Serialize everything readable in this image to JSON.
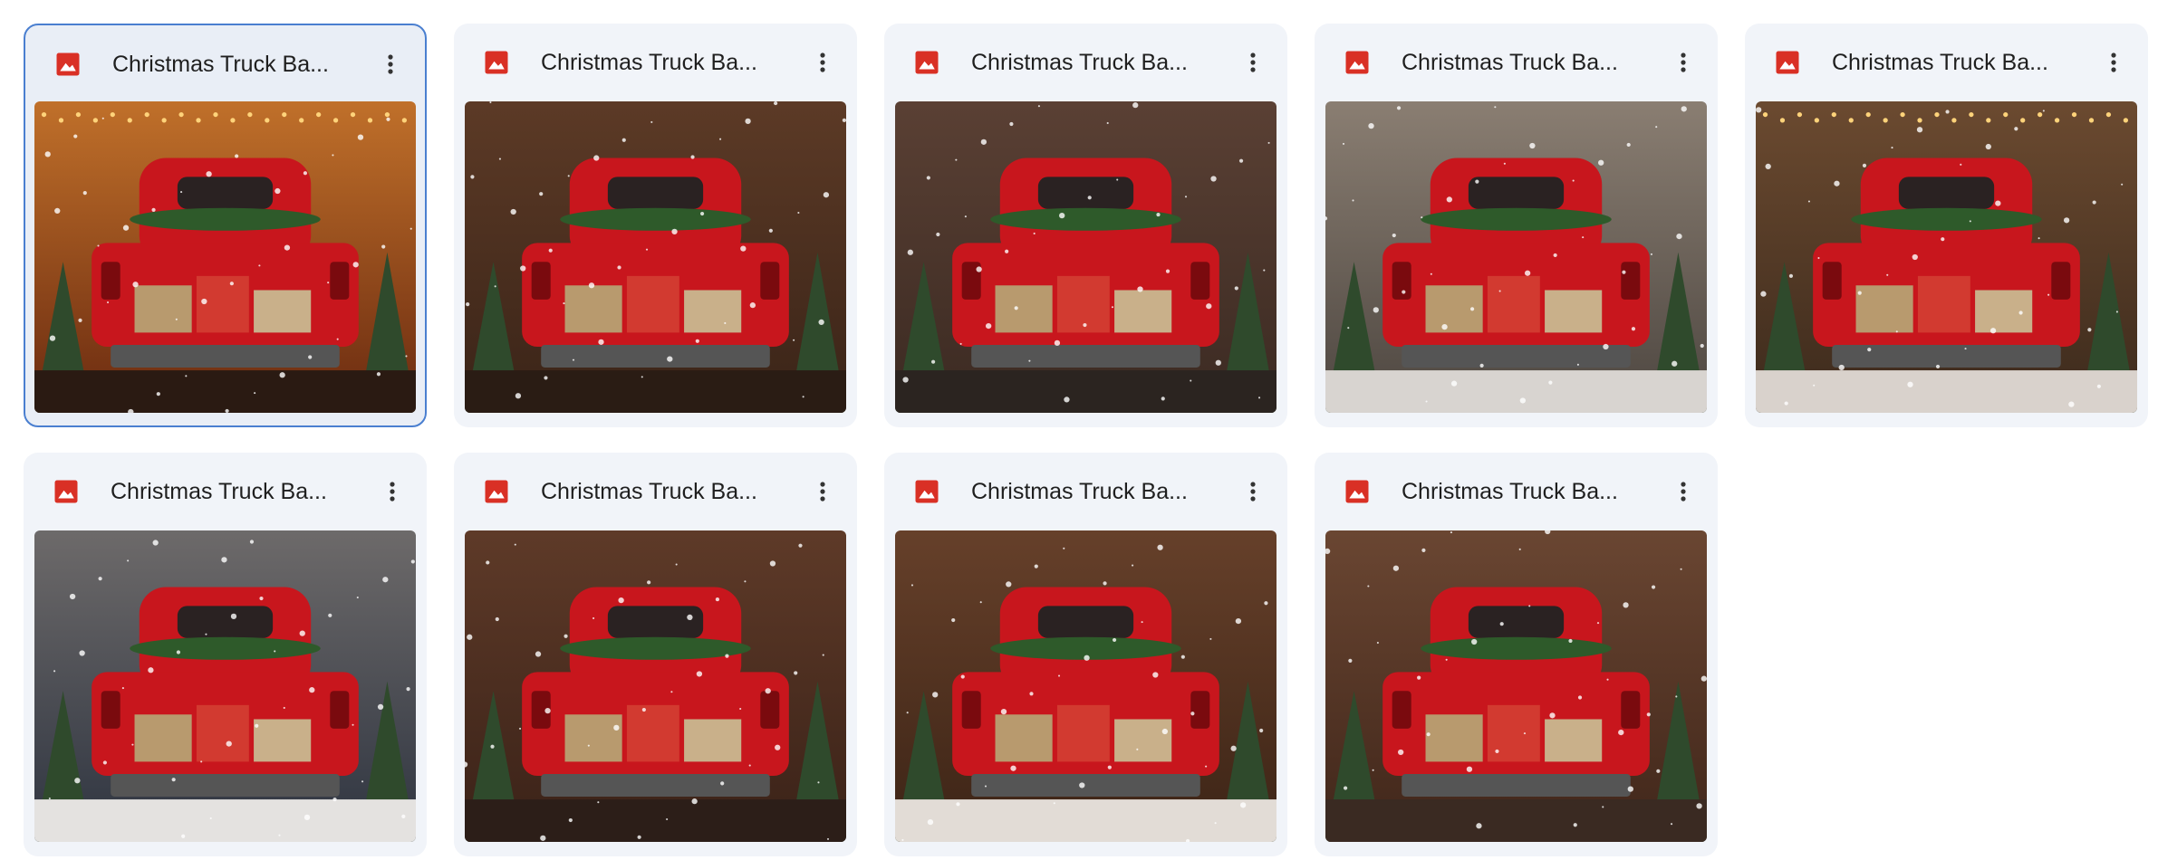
{
  "files": [
    {
      "title": "Christmas Truck Ba...",
      "selected": true,
      "scene": "lights-warm"
    },
    {
      "title": "Christmas Truck Ba...",
      "selected": false,
      "scene": "wood-brown"
    },
    {
      "title": "Christmas Truck Ba...",
      "selected": false,
      "scene": "garland-wood"
    },
    {
      "title": "Christmas Truck Ba...",
      "selected": false,
      "scene": "forest-mist"
    },
    {
      "title": "Christmas Truck Ba...",
      "selected": false,
      "scene": "barn-lights"
    },
    {
      "title": "Christmas Truck Ba...",
      "selected": false,
      "scene": "snow-forest"
    },
    {
      "title": "Christmas Truck Ba...",
      "selected": false,
      "scene": "wreath-wood"
    },
    {
      "title": "Christmas Truck Ba...",
      "selected": false,
      "scene": "lantern-wood"
    },
    {
      "title": "Christmas Truck Ba...",
      "selected": false,
      "scene": "wreath-arch"
    }
  ],
  "icons": {
    "file_type": "image-file-icon",
    "menu": "more-vert-icon"
  },
  "colors": {
    "file_icon": "#d93025",
    "truck_red": "#c8161d",
    "selection_border": "#4a7fd0"
  }
}
